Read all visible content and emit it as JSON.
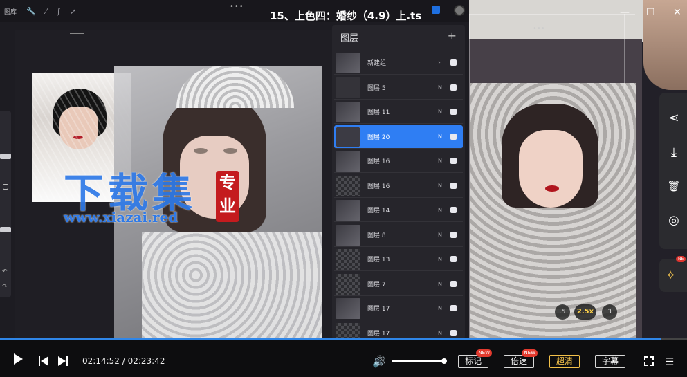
{
  "window": {
    "title": "15、上色四：婚纱（4.9）上.ts",
    "minimize_glyph": "—",
    "maximize_glyph": "☐",
    "close_glyph": "✕"
  },
  "procreate": {
    "gallery_label": "图库",
    "toolbar_dots": "•••",
    "tools": [
      "wrench-icon",
      "magic-wand-icon",
      "selection-icon",
      "transform-arrow-icon"
    ],
    "undo_glyph": "↶",
    "redo_glyph": "↷"
  },
  "watermark": {
    "main": "下载集",
    "seal": "专业",
    "url": "www.xiazai.red"
  },
  "layers_panel": {
    "title": "图层",
    "add_glyph": "+",
    "chevron_glyph": "›",
    "rows": [
      {
        "name": "新建组",
        "blend": "",
        "thumb": "sketch",
        "group": true
      },
      {
        "name": "图层 5",
        "blend": "N",
        "thumb": "plain"
      },
      {
        "name": "图层 11",
        "blend": "N",
        "thumb": "sketch"
      },
      {
        "name": "图层 20",
        "blend": "N",
        "thumb": "plain",
        "active": true
      },
      {
        "name": "图层 16",
        "blend": "N",
        "thumb": "sketch"
      },
      {
        "name": "图层 16",
        "blend": "N",
        "thumb": "checker"
      },
      {
        "name": "图层 14",
        "blend": "N",
        "thumb": "sketch"
      },
      {
        "name": "图层 8",
        "blend": "N",
        "thumb": "sketch"
      },
      {
        "name": "图层 13",
        "blend": "N",
        "thumb": "checker"
      },
      {
        "name": "图层 7",
        "blend": "N",
        "thumb": "checker"
      },
      {
        "name": "图层 17",
        "blend": "N",
        "thumb": "sketch"
      },
      {
        "name": "图层 17",
        "blend": "N",
        "thumb": "checker"
      }
    ]
  },
  "right_video": {
    "dots": "•••",
    "speed_options": [
      ".5",
      "2.5x",
      "3"
    ],
    "speed_selected": "2.5x"
  },
  "side_actions": [
    {
      "icon": "share-icon",
      "glyph": "⋖"
    },
    {
      "icon": "download-icon",
      "glyph": "⤓"
    },
    {
      "icon": "trash-icon",
      "glyph": "🗑"
    },
    {
      "icon": "target-icon",
      "glyph": "◎"
    }
  ],
  "side_pin": {
    "glyph": "✧",
    "badge": "NE"
  },
  "player": {
    "progress": 0.9625,
    "current_time": "02:14:52",
    "separator": " / ",
    "total_time": "02:23:42",
    "volume": 1.0,
    "volume_glyph": "🔊",
    "buttons": {
      "mark": "标记",
      "speed": "倍速",
      "hd": "超清",
      "subtitle": "字幕"
    },
    "new_badge": "NEW",
    "list_glyph": "☰"
  },
  "colors": {
    "accent": "#2f86e8",
    "layer_active": "#2f7ef3",
    "hd": "#f3c14a",
    "badge": "#e33a2e"
  }
}
